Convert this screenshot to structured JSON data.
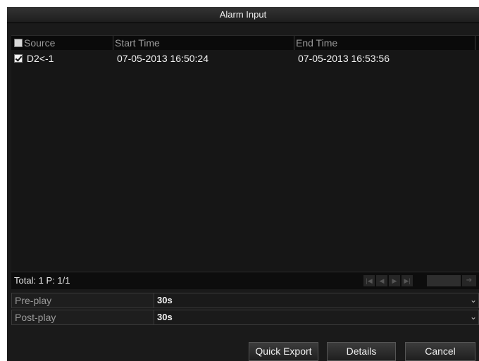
{
  "dialog": {
    "title": "Alarm Input"
  },
  "table": {
    "columns": [
      "Source",
      "Start Time",
      "End Time"
    ],
    "rows": [
      {
        "checked": true,
        "source": "D2<-1",
        "start": "07-05-2013 16:50:24",
        "end": "07-05-2013 16:53:56"
      }
    ]
  },
  "footer": {
    "total": "Total: 1  P: 1/1"
  },
  "params": {
    "preplay": {
      "label": "Pre-play",
      "value": "30s"
    },
    "postplay": {
      "label": "Post-play",
      "value": "30s"
    }
  },
  "buttons": {
    "quick_export": "Quick Export",
    "details": "Details",
    "cancel": "Cancel"
  }
}
